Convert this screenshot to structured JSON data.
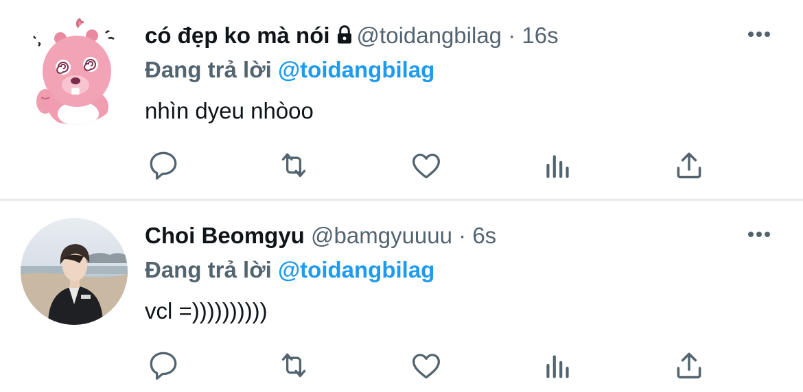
{
  "colors": {
    "text_primary": "#0f1419",
    "text_secondary": "#536471",
    "accent": "#1d9bf0",
    "divider": "#e7eaed"
  },
  "tweets": [
    {
      "display_name": "có đẹp ko mà nói",
      "protected": true,
      "handle": "@toidangbilag",
      "separator": "·",
      "time": "16s",
      "reply_prefix": "Đang trả lời",
      "reply_to": "@toidangbilag",
      "text": "nhìn dyeu nhòoo",
      "avatar_icon": "pink-beaver-avatar",
      "actions": [
        "reply-icon",
        "retweet-icon",
        "like-icon",
        "views-icon",
        "share-icon"
      ]
    },
    {
      "display_name": "Choi Beomgyu",
      "protected": false,
      "handle": "@bamgyuuuu",
      "separator": "·",
      "time": "6s",
      "reply_prefix": "Đang trả lời",
      "reply_to": "@toidangbilag",
      "text": "vcl =))))))))))",
      "avatar_icon": "photo-avatar",
      "actions": [
        "reply-icon",
        "retweet-icon",
        "like-icon",
        "views-icon",
        "share-icon"
      ]
    }
  ]
}
